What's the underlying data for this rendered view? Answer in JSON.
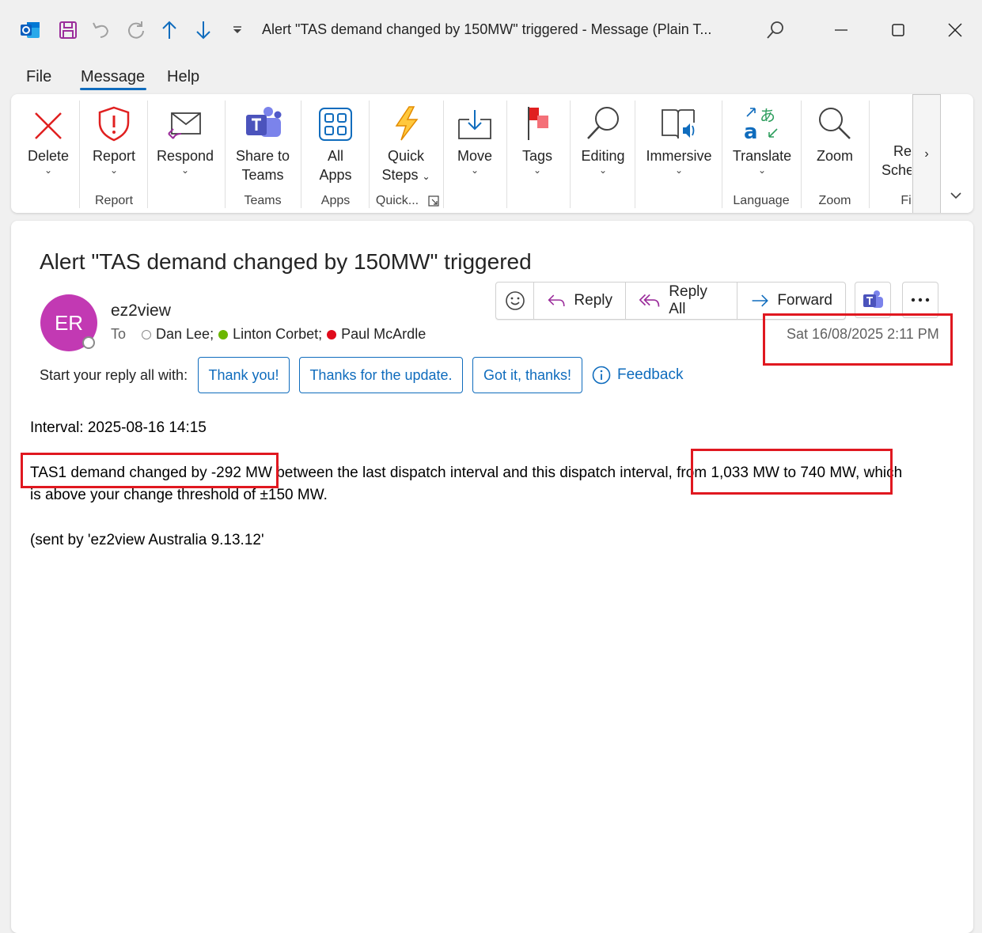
{
  "window": {
    "title": "Alert \"TAS demand changed by 150MW\" triggered  -  Message (Plain T...",
    "quick_access_icons": [
      "outlook-icon",
      "save-icon",
      "undo-icon",
      "redo-icon",
      "up-arrow-icon",
      "down-arrow-icon",
      "customize-dropdown-icon"
    ],
    "controls": [
      "search-icon",
      "minimize-icon",
      "maximize-icon",
      "close-icon"
    ]
  },
  "menu": {
    "tabs": [
      "File",
      "Message",
      "Help"
    ],
    "active": "Message"
  },
  "ribbon": {
    "buttons": {
      "delete": "Delete",
      "report": "Report",
      "respond": "Respond",
      "share_line1": "Share to",
      "share_line2": "Teams",
      "apps_line1": "All",
      "apps_line2": "Apps",
      "quick_line1": "Quick",
      "quick_line2": "Steps",
      "move": "Move",
      "tags": "Tags",
      "editing": "Editing",
      "immersive": "Immersive",
      "translate": "Translate",
      "zoom": "Zoom",
      "cut_line1": "Re",
      "cut_line2": "Sche"
    },
    "groups": {
      "report": "Report",
      "teams": "Teams",
      "apps": "Apps",
      "quick": "Quick...",
      "language": "Language",
      "zoom": "Zoom",
      "cut": "Fi"
    },
    "accent_delete": "#e02020",
    "accent_teams": "#5b5fc7",
    "accent_blue": "#0f6cbd"
  },
  "message": {
    "subject": "Alert \"TAS demand changed by 150MW\" triggered",
    "avatar_initials": "ER",
    "avatar_color": "#c239b3",
    "sender": "ez2view",
    "to_label": "To",
    "recipients": [
      {
        "name": "Dan Lee;",
        "status_color": "#ffffff"
      },
      {
        "name": "Linton Corbet;",
        "status_color": "#6bb700"
      },
      {
        "name": "Paul McArdle",
        "status_color": "#e00b1c"
      }
    ],
    "date": "Sat 16/08/2025 2:11 PM",
    "actions": {
      "reply": "Reply",
      "reply_all": "Reply All",
      "forward": "Forward"
    },
    "quick_reply_label": "Start your reply all with:",
    "quick_replies": [
      "Thank you!",
      "Thanks for the update.",
      "Got it, thanks!"
    ],
    "feedback": "Feedback",
    "body": {
      "interval": "Interval: 2025-08-16 14:15",
      "line1": "TAS1 demand changed by -292 MW between the last dispatch interval and this dispatch interval, from 1,033 MW to 740 MW, which",
      "line2": "is above your change threshold of ±150 MW.",
      "signature": "(sent by 'ez2view Australia 9.13.12'"
    },
    "highlight_color": "#e01820"
  }
}
